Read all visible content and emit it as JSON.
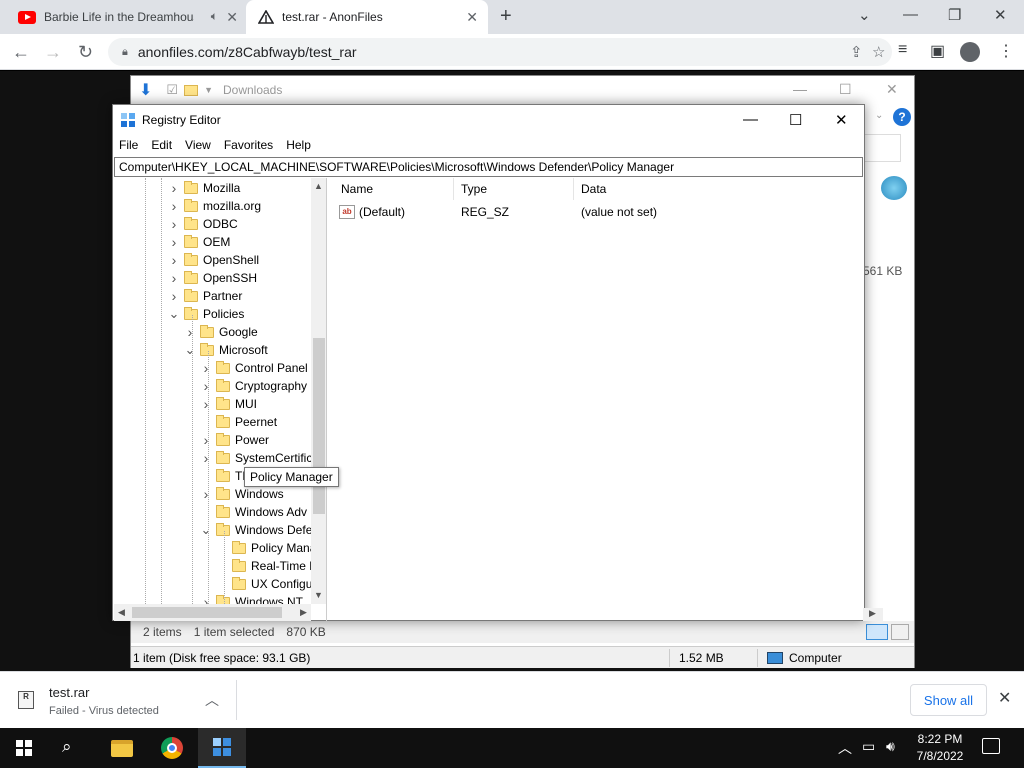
{
  "browser": {
    "tabs": [
      {
        "title": "Barbie Life in the Dreamhouse",
        "icon": "youtube-icon",
        "audio": true
      },
      {
        "title": "test.rar - AnonFiles",
        "icon": "anonfiles-icon",
        "active": true
      }
    ],
    "url": "anonfiles.com/z8Cabfwayb/test_rar"
  },
  "explorer": {
    "title": "Downloads",
    "size_peek": "561 KB",
    "status_items": "2 items",
    "status_selected": "1 item selected",
    "status_size": "870 KB",
    "disk_free": "1 item (Disk free space: 93.1 GB)",
    "disk_size": "1.52 MB",
    "location": "Computer"
  },
  "regedit": {
    "title": "Registry Editor",
    "menu": [
      "File",
      "Edit",
      "View",
      "Favorites",
      "Help"
    ],
    "path": "Computer\\HKEY_LOCAL_MACHINE\\SOFTWARE\\Policies\\Microsoft\\Windows Defender\\Policy Manager",
    "tree": [
      {
        "label": "Mozilla",
        "level": 0,
        "state": "collapsed"
      },
      {
        "label": "mozilla.org",
        "level": 0,
        "state": "collapsed"
      },
      {
        "label": "ODBC",
        "level": 0,
        "state": "collapsed"
      },
      {
        "label": "OEM",
        "level": 0,
        "state": "collapsed"
      },
      {
        "label": "OpenShell",
        "level": 0,
        "state": "collapsed"
      },
      {
        "label": "OpenSSH",
        "level": 0,
        "state": "collapsed"
      },
      {
        "label": "Partner",
        "level": 0,
        "state": "collapsed"
      },
      {
        "label": "Policies",
        "level": 0,
        "state": "expanded"
      },
      {
        "label": "Google",
        "level": 1,
        "state": "collapsed"
      },
      {
        "label": "Microsoft",
        "level": 1,
        "state": "expanded"
      },
      {
        "label": "Control Panel",
        "level": 2,
        "state": "collapsed"
      },
      {
        "label": "Cryptography",
        "level": 2,
        "state": "collapsed"
      },
      {
        "label": "MUI",
        "level": 2,
        "state": "collapsed"
      },
      {
        "label": "Peernet",
        "level": 2,
        "state": "none"
      },
      {
        "label": "Power",
        "level": 2,
        "state": "collapsed"
      },
      {
        "label": "SystemCertific",
        "level": 2,
        "state": "collapsed"
      },
      {
        "label": "TPM",
        "level": 2,
        "state": "none"
      },
      {
        "label": "Windows",
        "level": 2,
        "state": "collapsed"
      },
      {
        "label": "Windows Adv",
        "level": 2,
        "state": "none"
      },
      {
        "label": "Windows Defe",
        "level": 2,
        "state": "expanded"
      },
      {
        "label": "Policy Manager",
        "level": 3,
        "state": "none",
        "selected": true
      },
      {
        "label": "Real-Time F",
        "level": 3,
        "state": "none"
      },
      {
        "label": "UX Configu",
        "level": 3,
        "state": "none"
      },
      {
        "label": "Windows NT",
        "level": 2,
        "state": "collapsed"
      }
    ],
    "tooltip": "Policy Manager",
    "columns": [
      "Name",
      "Type",
      "Data"
    ],
    "values": [
      {
        "name": "(Default)",
        "type": "REG_SZ",
        "data": "(value not set)"
      }
    ]
  },
  "download": {
    "filename": "test.rar",
    "status": "Failed - Virus detected",
    "show_all": "Show all"
  },
  "taskbar": {
    "time": "8:22 PM",
    "date": "7/8/2022"
  }
}
